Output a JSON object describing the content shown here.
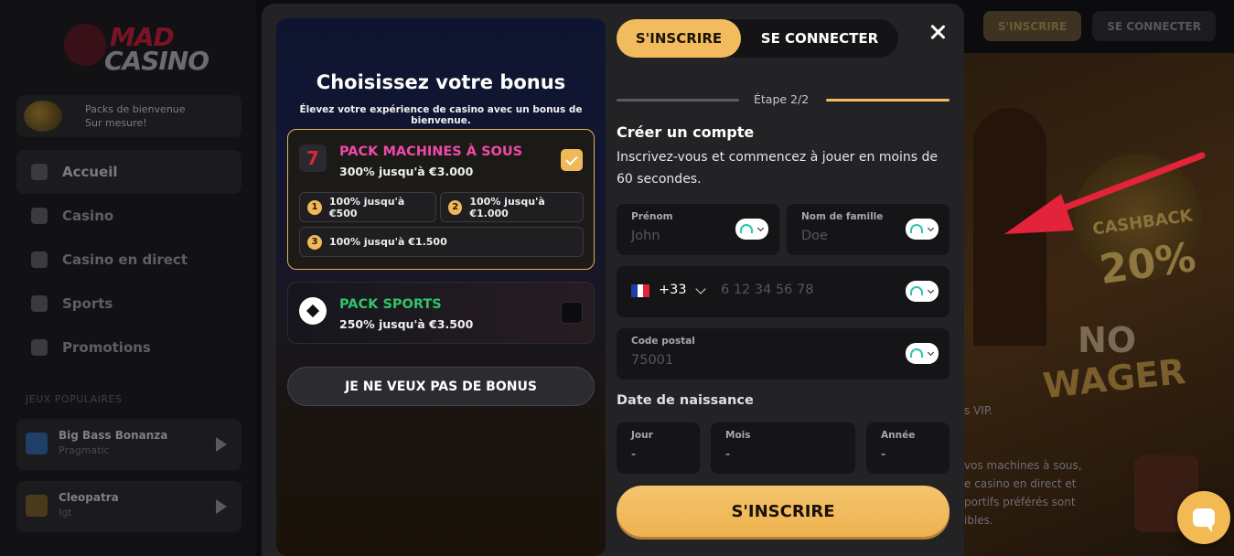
{
  "background": {
    "logo": {
      "line1": "MAD",
      "line2": "CASINO"
    },
    "welcome": {
      "line1": "Packs de bienvenue",
      "line2": "Sur mesure!"
    },
    "nav": [
      {
        "label": "Accueil",
        "icon": "home-icon"
      },
      {
        "label": "Casino",
        "icon": "casino-icon"
      },
      {
        "label": "Casino en direct",
        "icon": "cards-icon"
      },
      {
        "label": "Sports",
        "icon": "ball-icon"
      },
      {
        "label": "Promotions",
        "icon": "gift-icon"
      }
    ],
    "popular_label": "JEUX POPULAIRES",
    "games": [
      {
        "title": "Big Bass Bonanza",
        "provider": "Pragmatic"
      },
      {
        "title": "Cleopatra",
        "provider": "Igt"
      }
    ],
    "topbar": {
      "signup": "S'INSCRIRE",
      "login": "SE CONNECTER"
    },
    "banner": {
      "cashback": "CASHBACK",
      "percent": "20%",
      "no": "NO",
      "wager": "WAGER",
      "text_vip": "s VIP.",
      "text_lines": [
        "vos machines à sous,",
        "e casino en direct et",
        "portifs préférés sont",
        "ibles."
      ]
    }
  },
  "modal": {
    "title": "Choisissez votre bonus",
    "subtitle": "Élevez votre expérience de casino avec un bonus de bienvenue.",
    "packs": [
      {
        "name": "PACK MACHINES À SOUS",
        "amount": "300% jusqu'à €3.000",
        "icon": "slot-machine-icon",
        "selected": true,
        "tiers": [
          {
            "num": "1",
            "label": "100% jusqu'à €500"
          },
          {
            "num": "2",
            "label": "100% jusqu'à €1.000"
          },
          {
            "num": "3",
            "label": "100% jusqu'à €1.500"
          }
        ]
      },
      {
        "name": "PACK SPORTS",
        "amount": "250% jusqu'à €3.500",
        "icon": "soccer-ball-icon",
        "selected": false
      }
    ],
    "no_bonus": "JE NE VEUX PAS DE BONUS",
    "tabs": {
      "signup": "S'INSCRIRE",
      "login": "SE CONNECTER"
    },
    "step": "Étape 2/2",
    "form_title": "Créer un compte",
    "form_desc": "Inscrivez-vous et commencez à jouer en moins de 60 secondes.",
    "fields": {
      "first_name": {
        "label": "Prénom",
        "placeholder": "John"
      },
      "last_name": {
        "label": "Nom de famille",
        "placeholder": "Doe"
      },
      "phone": {
        "country_code": "+33",
        "placeholder": "6 12 34 56 78"
      },
      "postal": {
        "label": "Code postal",
        "placeholder": "75001"
      }
    },
    "dob": {
      "label": "Date de naissance",
      "day": {
        "label": "Jour",
        "value": "-"
      },
      "month": {
        "label": "Mois",
        "value": "-"
      },
      "year": {
        "label": "Année",
        "value": "-"
      }
    },
    "submit": "S'INSCRIRE"
  },
  "colors": {
    "accent": "#f2bc5e",
    "pink": "#f049a8",
    "green": "#33c26a",
    "arrow": "#e2233a"
  }
}
